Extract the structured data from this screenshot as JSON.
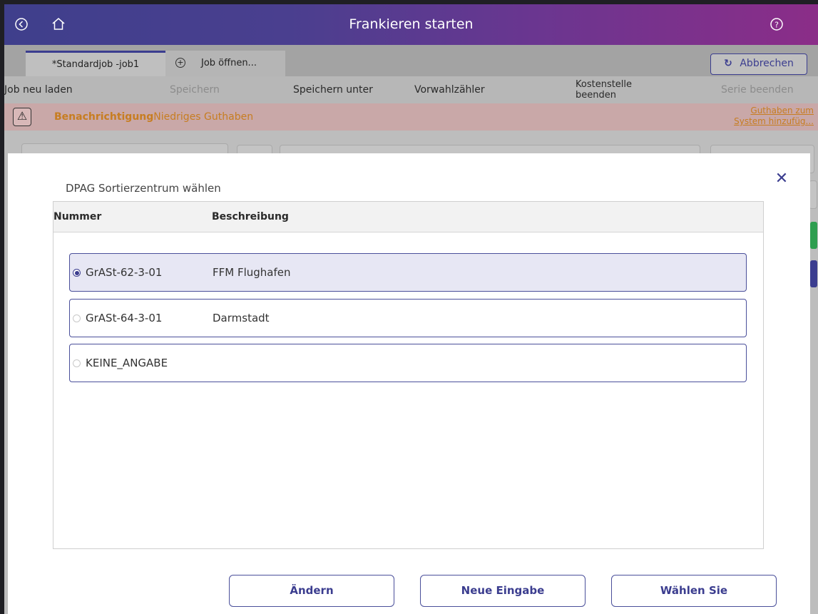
{
  "titlebar": {
    "title": "Frankieren starten",
    "icons": [
      "back-icon",
      "home-icon",
      "help-icon"
    ]
  },
  "tabs": {
    "active_label": "*Standardjob -job1",
    "open_label": "Job öffnen...",
    "cancel_label": "Abbrechen"
  },
  "toolbar": {
    "reload": "Job neu laden",
    "save": "Speichern",
    "save_as": "Speichern unter",
    "preset_counter": "Vorwahlzähler",
    "cost_center_end_line1": "Kostenstelle",
    "cost_center_end_line2": "beenden",
    "series_end": "Serie beenden"
  },
  "notification": {
    "label": "Benachrichtigung",
    "message": "Niedriges Guthaben",
    "link_line1": "Guthaben zum",
    "link_line2": "System hinzufüg..."
  },
  "dialog": {
    "title": "DPAG Sortierzentrum wählen",
    "columns": {
      "number": "Nummer",
      "description": "Beschreibung"
    },
    "rows": [
      {
        "number": "GrASt-62-3-01",
        "description": "FFM Flughafen",
        "selected": true
      },
      {
        "number": "GrASt-64-3-01",
        "description": "Darmstadt",
        "selected": false
      },
      {
        "number": "KEINE_ANGABE",
        "description": "",
        "selected": false
      }
    ],
    "buttons": {
      "change": "Ändern",
      "new_entry": "Neue Eingabe",
      "choose": "Wählen Sie"
    }
  },
  "colors": {
    "accent": "#3b3d8f",
    "warning_text": "#c77d21",
    "selected_row": "#e7e7f4"
  }
}
